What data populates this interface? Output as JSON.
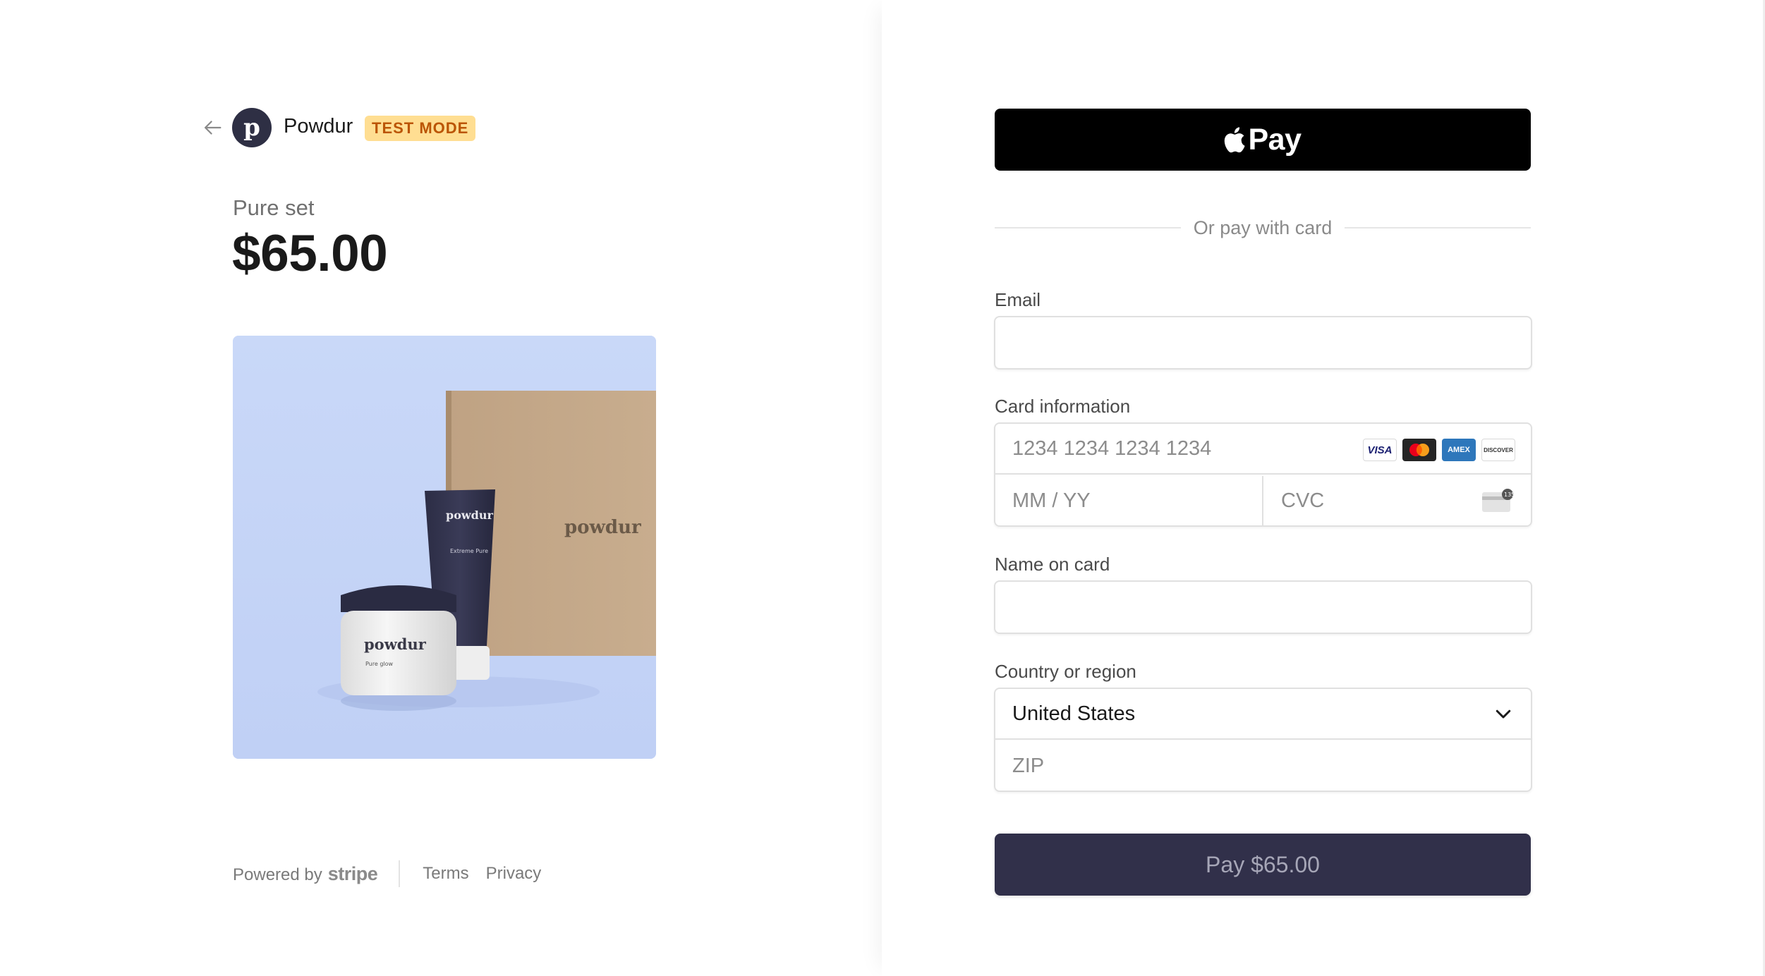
{
  "merchant": {
    "name": "Powdur",
    "avatar_letter": "p",
    "test_badge": "TEST MODE"
  },
  "product": {
    "name": "Pure set",
    "price": "$65.00",
    "image_alt_brand": "powdur",
    "image_labels": {
      "box": "powdur",
      "tube_brand": "powdur",
      "tube_name": "Extreme Pure",
      "jar_brand": "powdur",
      "jar_name": "Pure glow"
    }
  },
  "footer": {
    "powered_by": "Powered by",
    "stripe": "stripe",
    "terms": "Terms",
    "privacy": "Privacy"
  },
  "checkout": {
    "apple_pay_label": "Pay",
    "divider_text": "Or pay with card",
    "email_label": "Email",
    "email_value": "",
    "card_label": "Card information",
    "card_number_placeholder": "1234 1234 1234 1234",
    "expiry_placeholder": "MM / YY",
    "cvc_placeholder": "CVC",
    "card_brands": [
      "visa",
      "mastercard",
      "amex",
      "discover"
    ],
    "name_label": "Name on card",
    "name_value": "",
    "country_label": "Country or region",
    "country_value": "United States",
    "zip_placeholder": "ZIP",
    "pay_button": "Pay $65.00"
  },
  "colors": {
    "badge_bg": "#ffde92",
    "badge_text": "#bb5504",
    "pay_button_bg": "#31304a",
    "product_bg": "#c9d8f8"
  }
}
